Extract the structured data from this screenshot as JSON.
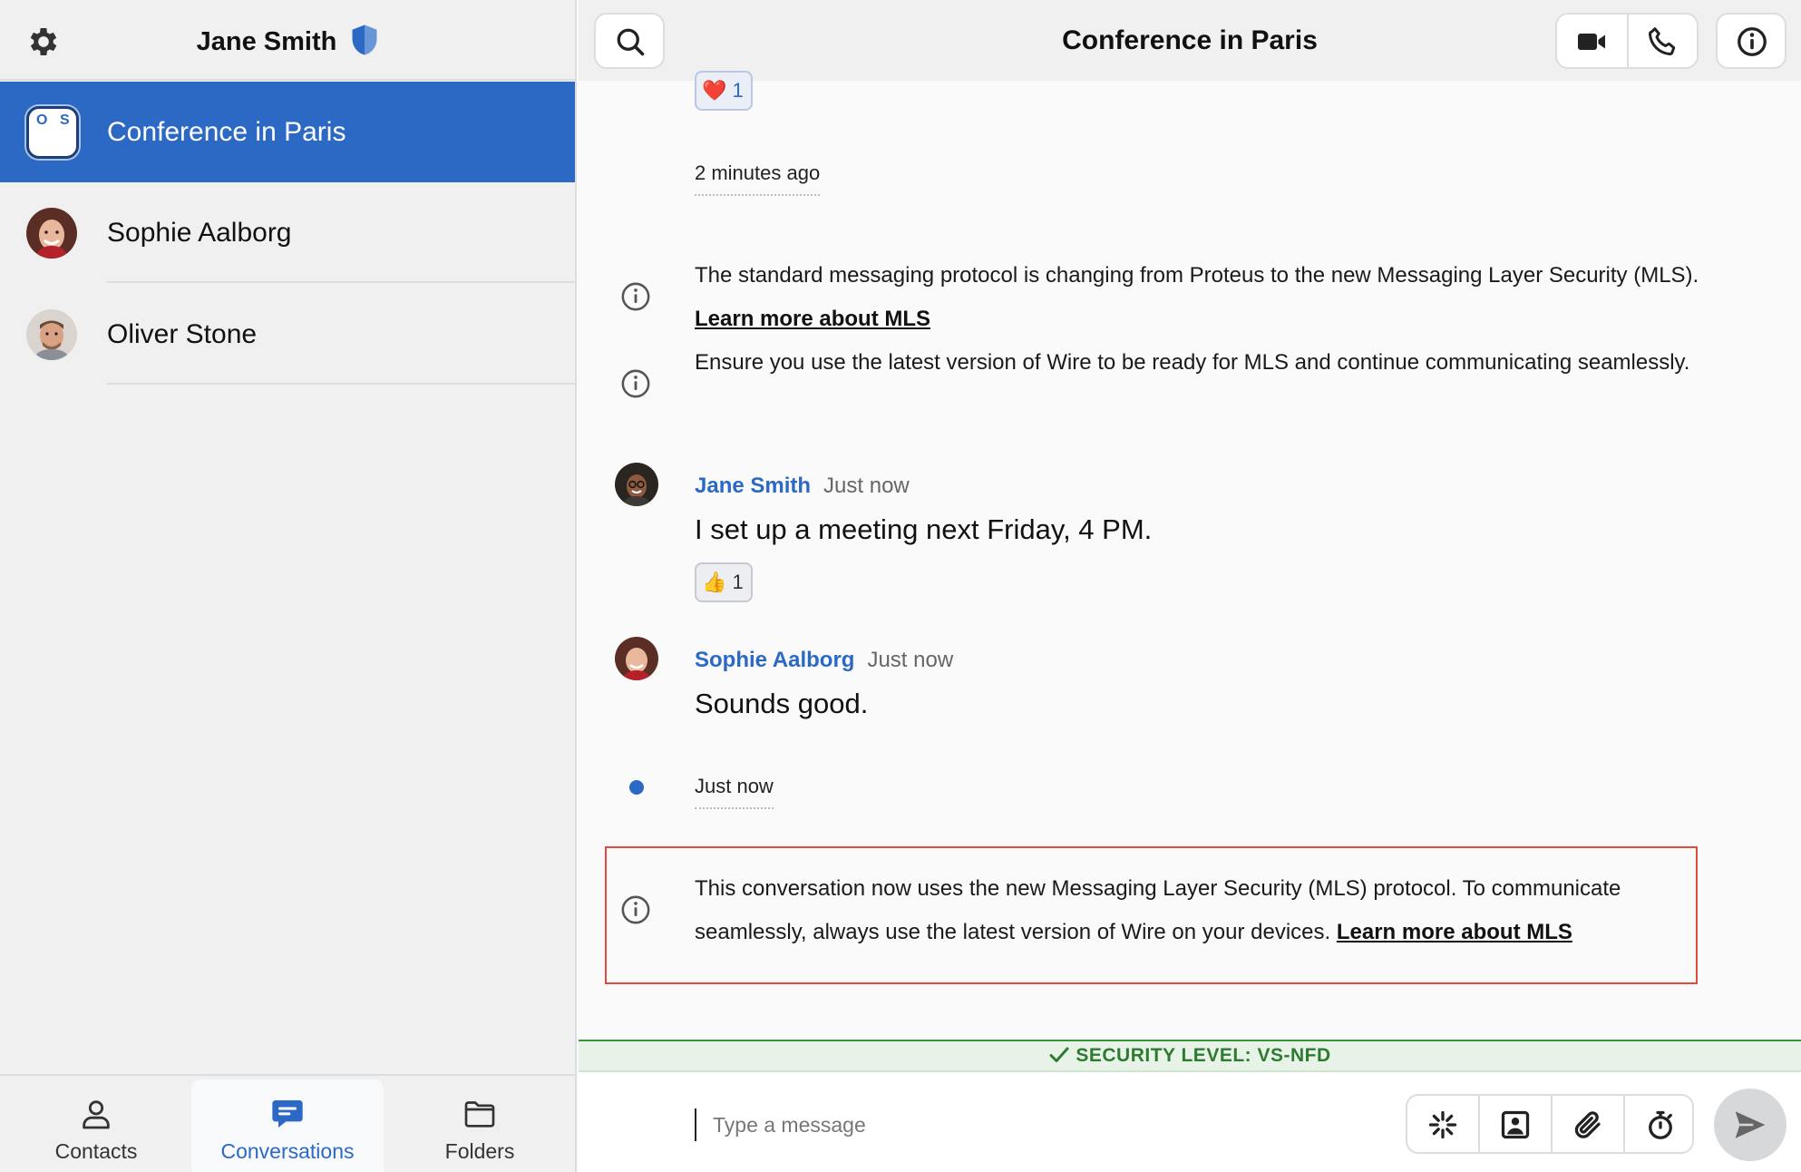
{
  "sidebar": {
    "user_name": "Jane Smith",
    "conversations": [
      {
        "name": "Conference in Paris",
        "initials": [
          "O",
          "S"
        ],
        "active": true
      },
      {
        "name": "Sophie Aalborg",
        "active": false
      },
      {
        "name": "Oliver Stone",
        "active": false
      }
    ],
    "tabs": [
      {
        "label": "Contacts",
        "active": false
      },
      {
        "label": "Conversations",
        "active": true
      },
      {
        "label": "Folders",
        "active": false
      }
    ]
  },
  "header": {
    "title": "Conference in Paris"
  },
  "messages": {
    "top_reaction": {
      "emoji": "❤️",
      "count": "1"
    },
    "timestamp_1": "2 minutes ago",
    "system_1_text": "The standard messaging protocol is changing from Proteus to the new Messaging Layer Security (MLS).",
    "system_1_link": "Learn more about MLS",
    "system_2_text": "Ensure you use the latest version of Wire to be ready for MLS and continue communicating seamlessly.",
    "msg_1": {
      "sender": "Jane Smith",
      "time": "Just now",
      "body": "I set up a meeting next Friday, 4 PM.",
      "reaction_emoji": "👍",
      "reaction_count": "1"
    },
    "msg_2": {
      "sender": "Sophie Aalborg",
      "time": "Just now",
      "body": "Sounds good."
    },
    "timestamp_2": "Just now",
    "system_3_text": "This conversation now uses the new Messaging Layer Security (MLS) protocol. To communicate seamlessly, always use the latest version of Wire on your devices.",
    "system_3_link": "Learn more about MLS"
  },
  "security_bar": {
    "label": "SECURITY LEVEL: VS-NFD"
  },
  "composer": {
    "placeholder": "Type a message",
    "value": ""
  },
  "colors": {
    "accent": "#2c69c5",
    "security_green": "#2f7a31",
    "highlight_border": "#e24a3b"
  },
  "icons": {
    "settings": "gear-icon",
    "verified": "shield-icon",
    "search": "search-icon",
    "video_call": "video-camera-icon",
    "audio_call": "phone-icon",
    "info": "info-icon",
    "contacts": "person-icon",
    "conversations": "chat-bubble-icon",
    "folders": "folder-icon",
    "ping": "ping-icon",
    "image": "image-icon",
    "attachment": "paperclip-icon",
    "timer": "stopwatch-icon",
    "send": "send-icon"
  }
}
